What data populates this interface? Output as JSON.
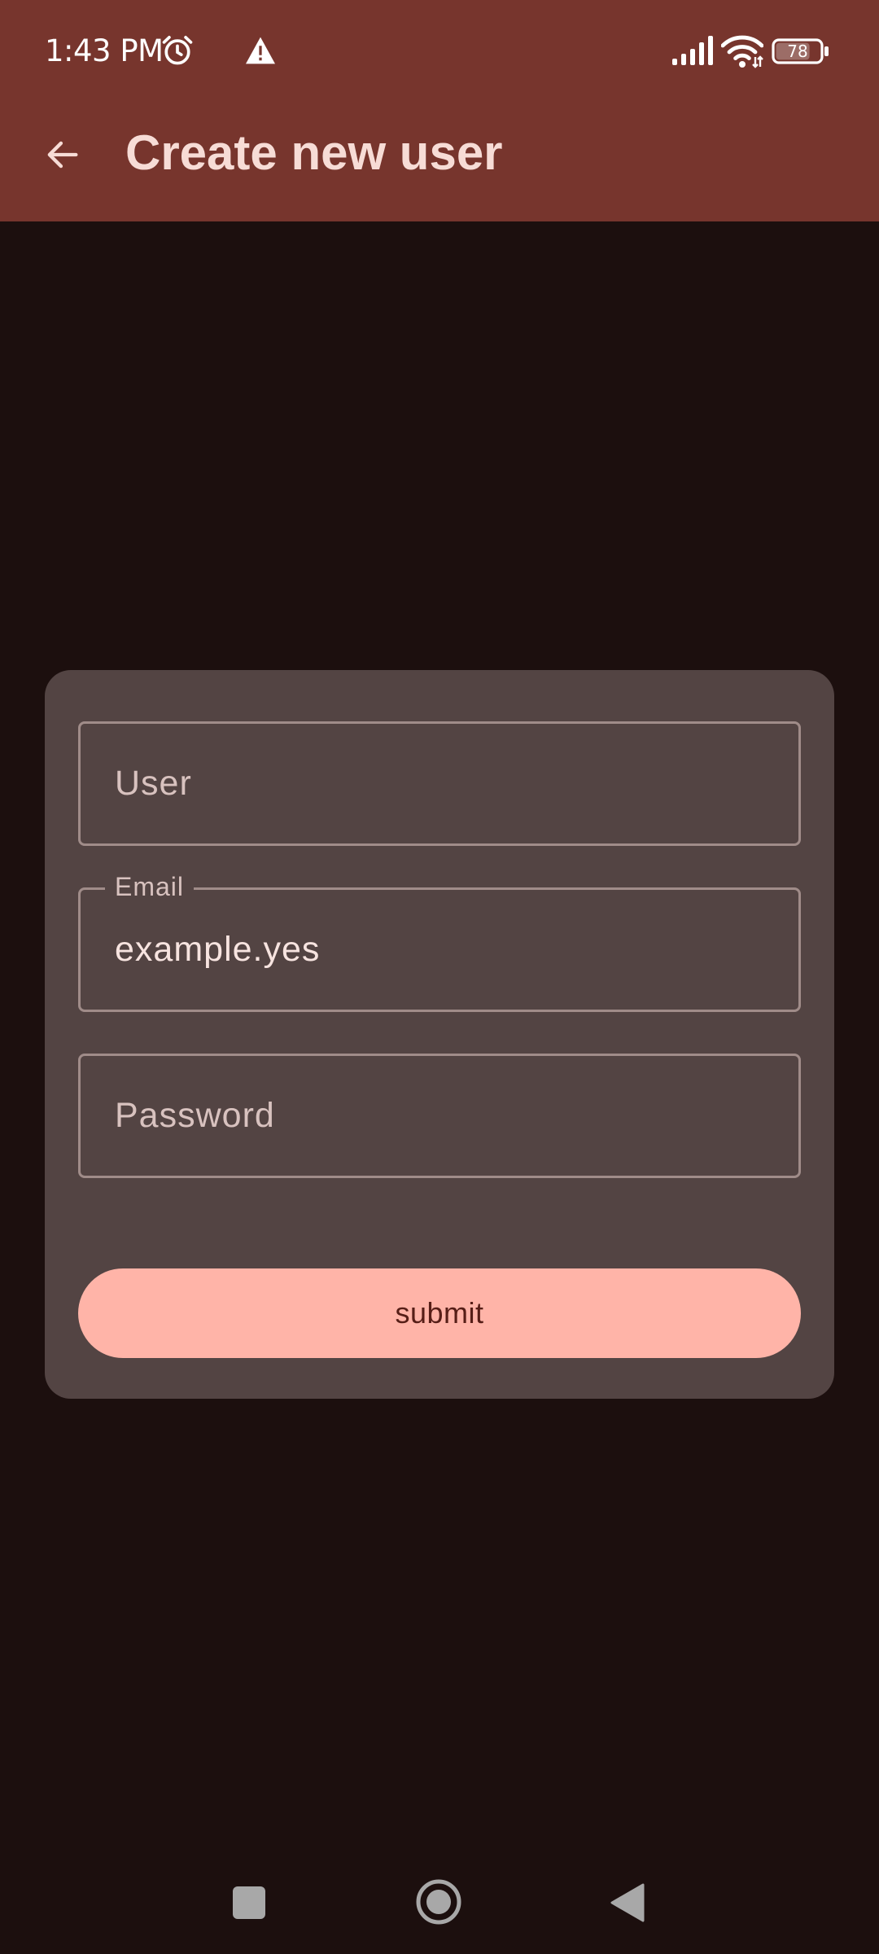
{
  "status_bar": {
    "time": "1:43 PM",
    "battery_level": "78",
    "icons": [
      "alarm-icon",
      "warning-icon",
      "signal-icon",
      "wifi-icon",
      "battery-icon"
    ]
  },
  "app_bar": {
    "title": "Create new user",
    "back_icon": "arrow-left-icon"
  },
  "form": {
    "user": {
      "placeholder": "User",
      "value": ""
    },
    "email": {
      "label": "Email",
      "value": "example.yes"
    },
    "password": {
      "placeholder": "Password",
      "value": ""
    },
    "submit_label": "submit"
  },
  "nav_bar": {
    "icons": [
      "recents-icon",
      "home-icon",
      "back-icon"
    ]
  },
  "colors": {
    "header": "#77352d",
    "background": "#1c0f0e",
    "card": "#534443",
    "field_border": "#a08c89",
    "primary": "#ffb4a8",
    "on_primary": "#561e17",
    "title_text": "#f7dcd6"
  }
}
